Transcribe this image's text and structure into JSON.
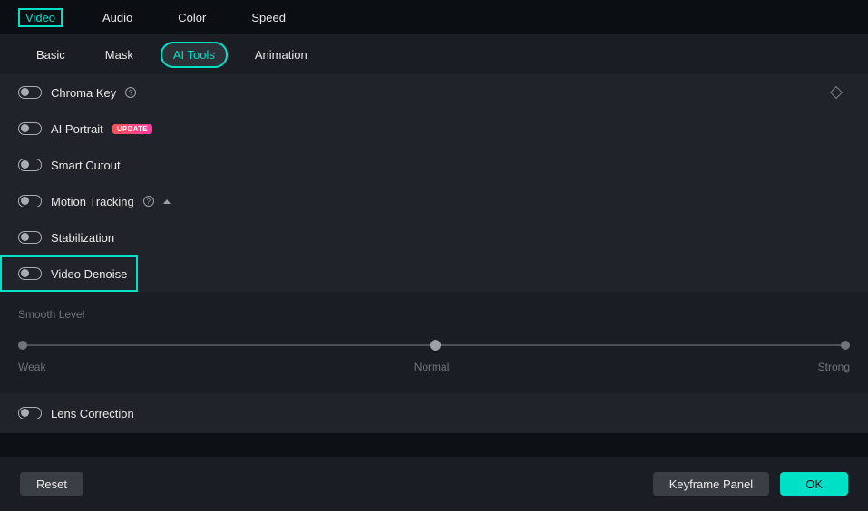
{
  "mainTabs": {
    "video": "Video",
    "audio": "Audio",
    "color": "Color",
    "speed": "Speed"
  },
  "subTabs": {
    "basic": "Basic",
    "mask": "Mask",
    "aitools": "AI Tools",
    "animation": "Animation"
  },
  "rows": {
    "chroma": "Chroma Key",
    "portrait": "AI Portrait",
    "portraitBadge": "UPDATE",
    "cutout": "Smart Cutout",
    "motion": "Motion Tracking",
    "stab": "Stabilization",
    "denoise": "Video Denoise",
    "lens": "Lens Correction"
  },
  "denoise": {
    "label": "Smooth Level",
    "weak": "Weak",
    "normal": "Normal",
    "strong": "Strong"
  },
  "footer": {
    "reset": "Reset",
    "keyframe": "Keyframe Panel",
    "ok": "OK"
  }
}
